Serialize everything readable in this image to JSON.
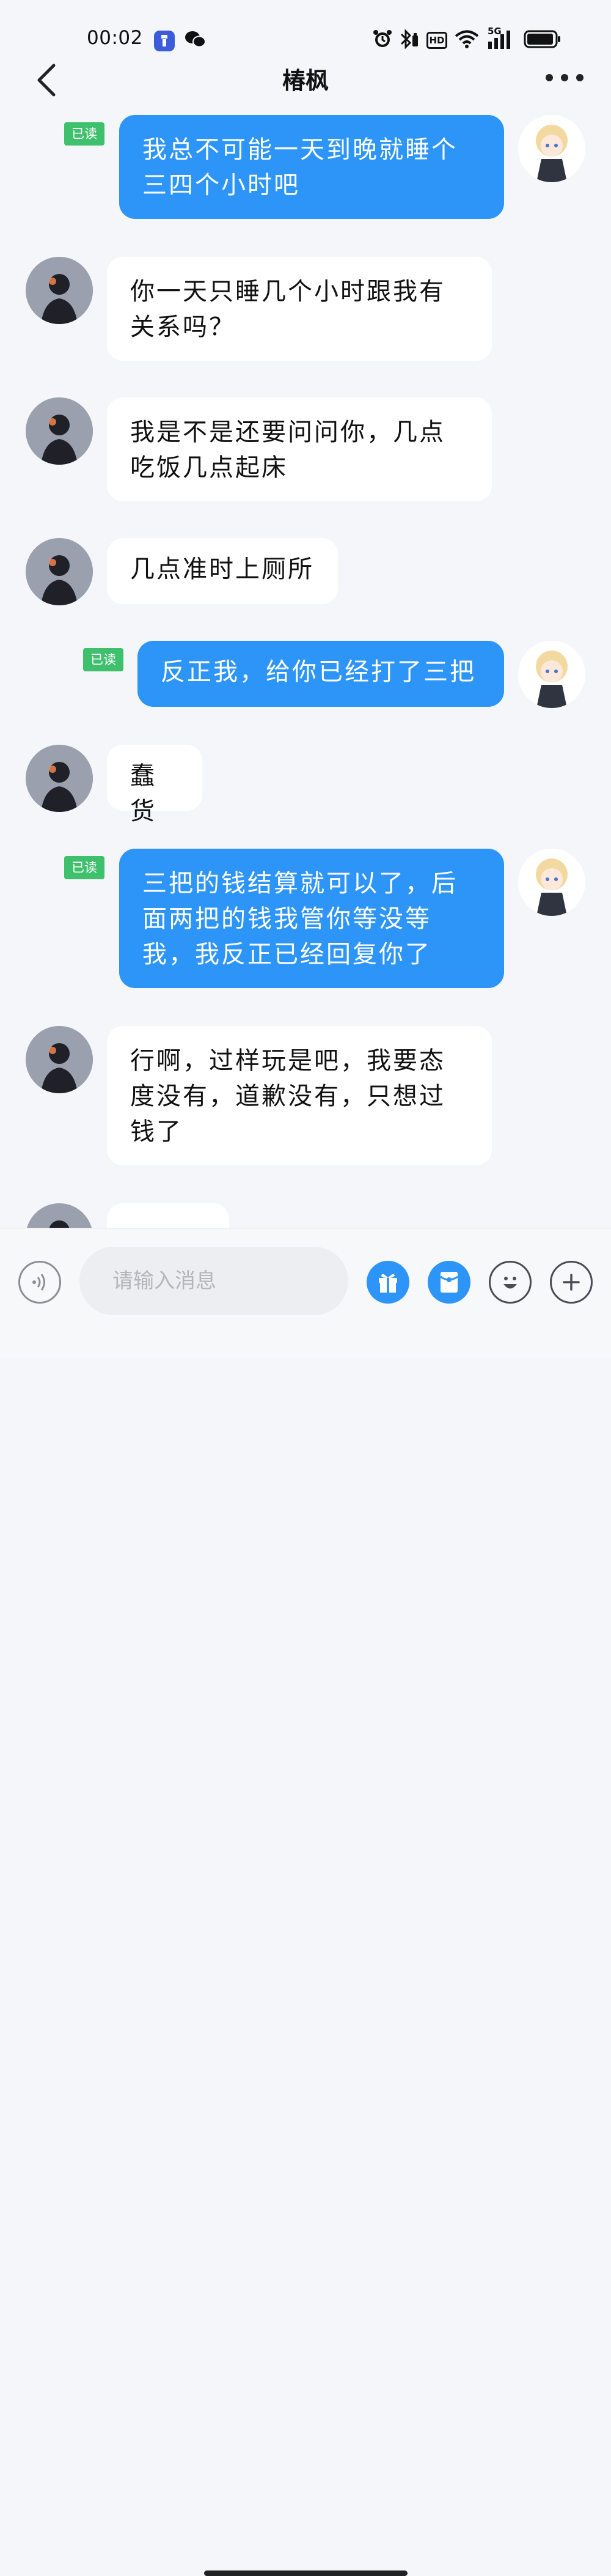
{
  "status_bar": {
    "time": "00:02",
    "network": "5G",
    "hd": "HD"
  },
  "header": {
    "title": "椿枫"
  },
  "messages": [
    {
      "side": "self",
      "text": "我总不可能一天到晚就睡个三四个小时吧",
      "badge": "已读"
    },
    {
      "side": "other",
      "text": "你一天只睡几个小时跟我有关系吗？"
    },
    {
      "side": "other",
      "text": "我是不是还要问问你，几点吃饭几点起床"
    },
    {
      "side": "other",
      "text": "几点准时上厕所"
    },
    {
      "side": "self",
      "text": "反正我，给你已经打了三把",
      "badge": "已读"
    },
    {
      "side": "other",
      "text": "蠢货"
    },
    {
      "side": "self",
      "text": "三把的钱结算就可以了，后面两把的钱我管你等没等我，我反正已经回复你了",
      "badge": "已读"
    },
    {
      "side": "other",
      "text": "行啊，过样玩是吧，我要态度没有，道歉没有，只想过钱了"
    },
    {
      "side": "other",
      "text": ""
    }
  ],
  "input": {
    "placeholder": "请输入消息"
  },
  "icons": {
    "back": "chevron-left-icon",
    "more": "more-dots-icon",
    "voice": "voice-icon",
    "gift": "gift-icon",
    "red_packet": "red-packet-icon",
    "emoji": "emoji-icon",
    "plus": "plus-icon"
  },
  "colors": {
    "self_bubble": "#2d95f7",
    "read_badge": "#3ec06c",
    "background": "#f4f6f9"
  }
}
